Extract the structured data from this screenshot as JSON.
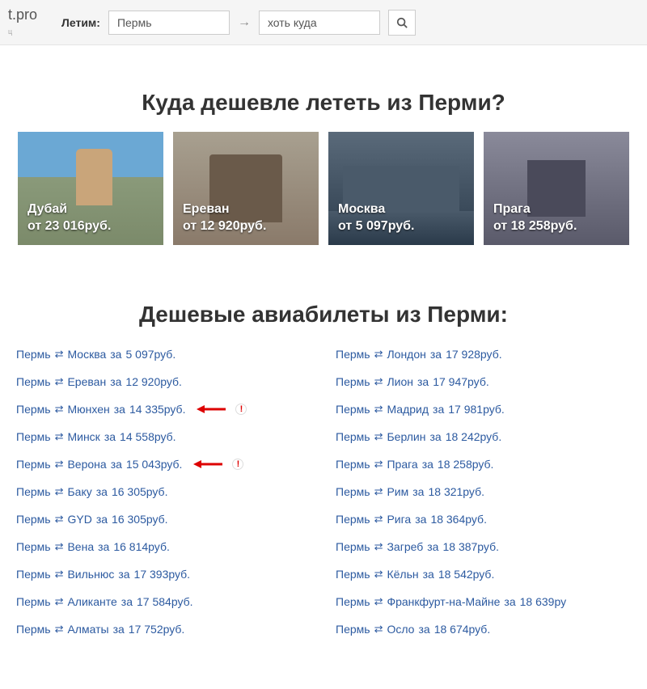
{
  "header": {
    "logo_suffix": "t.pro",
    "logo_sub": "ц",
    "search_label": "Летим:",
    "from_value": "Пермь",
    "arrow": "→",
    "to_value": "хоть куда"
  },
  "section1_title": "Куда дешевле лететь из Перми?",
  "cards": [
    {
      "city": "Дубай",
      "price": "от 23 016руб.",
      "cls": "card-dubai"
    },
    {
      "city": "Ереван",
      "price": "от 12 920руб.",
      "cls": "card-yerevan"
    },
    {
      "city": "Москва",
      "price": "от 5 097руб.",
      "cls": "card-moscow"
    },
    {
      "city": "Прага",
      "price": "от 18 258руб.",
      "cls": "card-prague"
    }
  ],
  "section2_title": "Дешевые авиабилеты из Перми:",
  "routes_left": [
    {
      "from": "Пермь",
      "to": "Москва",
      "price": "5 097руб.",
      "highlight": false
    },
    {
      "from": "Пермь",
      "to": "Ереван",
      "price": "12 920руб.",
      "highlight": false
    },
    {
      "from": "Пермь",
      "to": "Мюнхен",
      "price": "14 335руб.",
      "highlight": true
    },
    {
      "from": "Пермь",
      "to": "Минск",
      "price": "14 558руб.",
      "highlight": false
    },
    {
      "from": "Пермь",
      "to": "Верона",
      "price": "15 043руб.",
      "highlight": true
    },
    {
      "from": "Пермь",
      "to": "Баку",
      "price": "16 305руб.",
      "highlight": false
    },
    {
      "from": "Пермь",
      "to": "GYD",
      "price": "16 305руб.",
      "highlight": false
    },
    {
      "from": "Пермь",
      "to": "Вена",
      "price": "16 814руб.",
      "highlight": false
    },
    {
      "from": "Пермь",
      "to": "Вильнюс",
      "price": "17 393руб.",
      "highlight": false
    },
    {
      "from": "Пермь",
      "to": "Аликанте",
      "price": "17 584руб.",
      "highlight": false
    },
    {
      "from": "Пермь",
      "to": "Алматы",
      "price": "17 752руб.",
      "highlight": false
    }
  ],
  "routes_right": [
    {
      "from": "Пермь",
      "to": "Лондон",
      "price": "17 928руб.",
      "highlight": false
    },
    {
      "from": "Пермь",
      "to": "Лион",
      "price": "17 947руб.",
      "highlight": false
    },
    {
      "from": "Пермь",
      "to": "Мадрид",
      "price": "17 981руб.",
      "highlight": false
    },
    {
      "from": "Пермь",
      "to": "Берлин",
      "price": "18 242руб.",
      "highlight": false
    },
    {
      "from": "Пермь",
      "to": "Прага",
      "price": "18 258руб.",
      "highlight": false
    },
    {
      "from": "Пермь",
      "to": "Рим",
      "price": "18 321руб.",
      "highlight": false
    },
    {
      "from": "Пермь",
      "to": "Рига",
      "price": "18 364руб.",
      "highlight": false
    },
    {
      "from": "Пермь",
      "to": "Загреб",
      "price": "18 387руб.",
      "highlight": false
    },
    {
      "from": "Пермь",
      "to": "Кёльн",
      "price": "18 542руб.",
      "highlight": false
    },
    {
      "from": "Пермь",
      "to": "Франкфурт-на-Майне",
      "price": "18 639ру",
      "highlight": false
    },
    {
      "from": "Пермь",
      "to": "Осло",
      "price": "18 674руб.",
      "highlight": false
    }
  ],
  "glue": {
    "za": "за"
  },
  "bang": "!"
}
